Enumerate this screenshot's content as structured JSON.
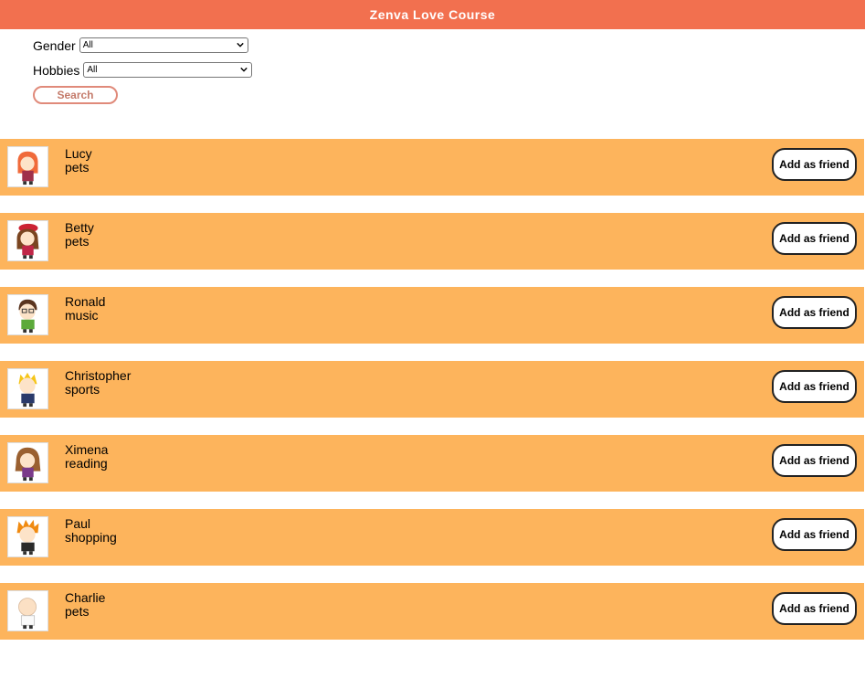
{
  "header": {
    "title": "Zenva Love Course"
  },
  "filters": {
    "gender_label": "Gender",
    "gender_value": "All",
    "hobbies_label": "Hobbies",
    "hobbies_value": "All",
    "search_label": "Search"
  },
  "add_friend_label": "Add as friend",
  "people": [
    {
      "name": "Lucy",
      "hobby": "pets"
    },
    {
      "name": "Betty",
      "hobby": "pets"
    },
    {
      "name": "Ronald",
      "hobby": "music"
    },
    {
      "name": "Christopher",
      "hobby": "sports"
    },
    {
      "name": "Ximena",
      "hobby": "reading"
    },
    {
      "name": "Paul",
      "hobby": "shopping"
    },
    {
      "name": "Charlie",
      "hobby": "pets"
    }
  ],
  "colors": {
    "header": "#f2704f",
    "card": "#fdb45c"
  }
}
